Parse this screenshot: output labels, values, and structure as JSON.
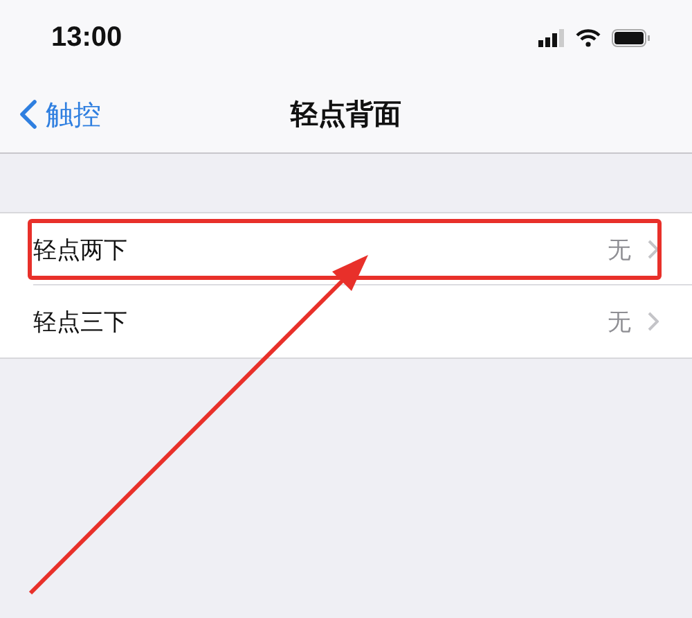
{
  "status_bar": {
    "time": "13:00"
  },
  "nav": {
    "back": "触控",
    "title": "轻点背面"
  },
  "rows": [
    {
      "label": "轻点两下",
      "value": "无",
      "highlighted": true
    },
    {
      "label": "轻点三下",
      "value": "无",
      "highlighted": false
    }
  ],
  "annotation": {
    "kind": "arrow"
  }
}
